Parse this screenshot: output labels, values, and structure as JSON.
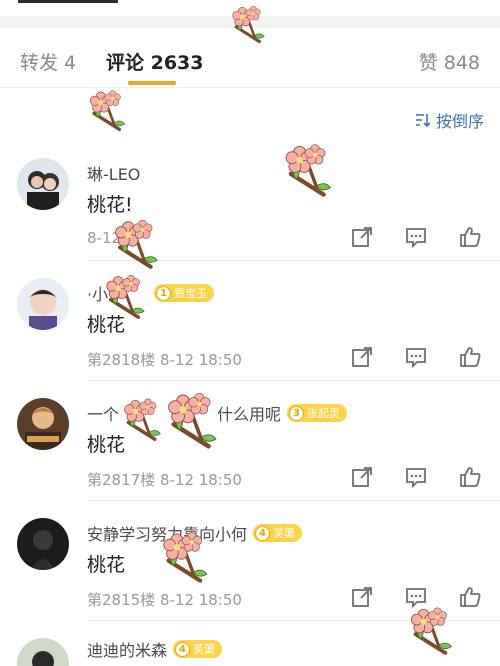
{
  "tabs": {
    "repost": "转发 4",
    "comments": "评论 2633",
    "likes": "赞 848"
  },
  "sort_label": "按倒序",
  "comments": [
    {
      "name": "琳-LEO",
      "badge_level": "",
      "badge_name": "",
      "text": "桃花!",
      "meta": "8-12"
    },
    {
      "name": "·小",
      "badge_level": "1",
      "badge_name": "贾宝玉",
      "text": "桃花",
      "meta": "第2818楼  8-12 18:50"
    },
    {
      "name": "一个",
      "name_tail": "什么用呢",
      "badge_level": "3",
      "badge_name": "张起灵",
      "text": "桃花",
      "meta": "第2817楼  8-12 18:50"
    },
    {
      "name": "安静学习努力靠向小何",
      "badge_level": "4",
      "badge_name": "芙蕖",
      "text": "桃花",
      "meta": "第2815楼  8-12 18:50"
    },
    {
      "name": "迪迪的米森",
      "badge_level": "4",
      "badge_name": "芙蕖"
    }
  ],
  "icons": [
    "share-icon",
    "comment-icon",
    "like-icon",
    "sort-icon",
    "peach-blossom-sticker"
  ],
  "colors": {
    "accent_underline": "#f7a325",
    "link_blue": "#3d73b2",
    "badge_yellow": "#ffd24a"
  }
}
